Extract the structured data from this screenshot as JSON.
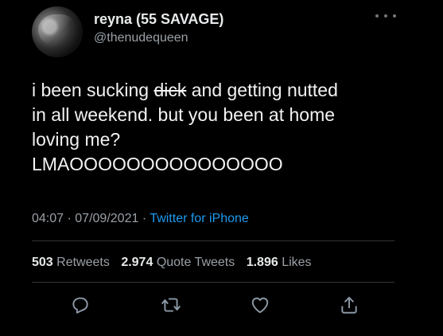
{
  "tweet": {
    "author_name": "reyna (55 SAVAGE)",
    "author_handle": "@thenudequeen",
    "more_icon": "more-horizontal-icon",
    "text_lines": [
      {
        "before": "i been sucking ",
        "struck": "dick",
        "after": " and getting nutted"
      },
      {
        "text": "in all weekend. but you been at home"
      },
      {
        "text": "loving me?"
      },
      {
        "text": "LMAOOOOOOOOOOOOOOO"
      }
    ],
    "time": "04:07",
    "date": "07/09/2021",
    "separator": "·",
    "source": "Twitter for iPhone",
    "colors": {
      "background": "#000000",
      "text": "#e7e9ea",
      "secondary": "#9aa0a6",
      "link": "#1d9bf0",
      "divider": "#2f3336"
    }
  },
  "stats": {
    "retweets_count": "503",
    "retweets_label": "Retweets",
    "quotes_count": "2.974",
    "quotes_label": "Quote Tweets",
    "likes_count": "1.896",
    "likes_label": "Likes"
  },
  "actions": {
    "reply_icon": "reply-icon",
    "retweet_icon": "retweet-icon",
    "like_icon": "heart-icon",
    "share_icon": "share-icon"
  }
}
